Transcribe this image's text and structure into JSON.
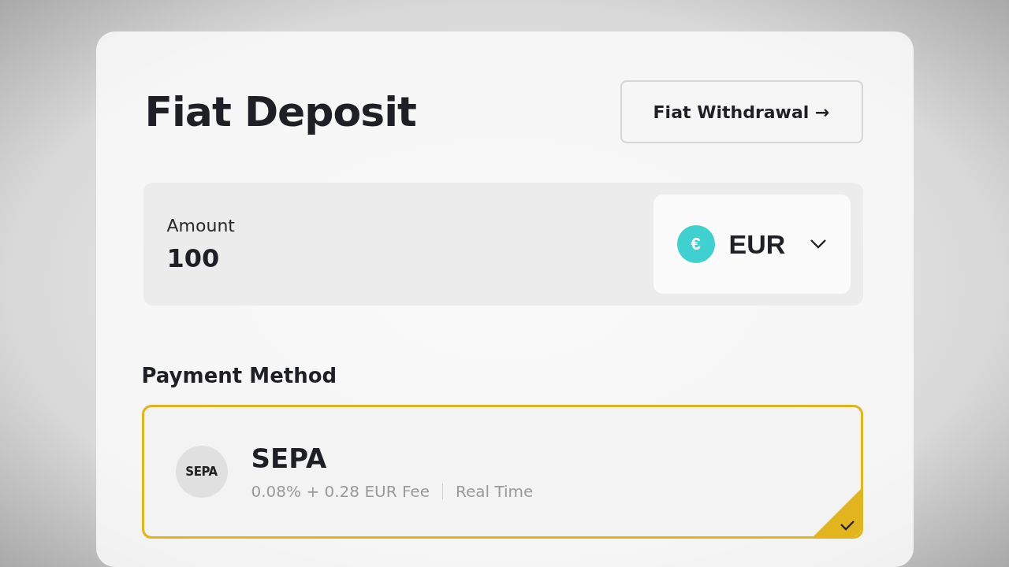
{
  "title": "Fiat Deposit",
  "withdraw_button": {
    "label": "Fiat Withdrawal →"
  },
  "amount": {
    "label": "Amount",
    "value": "100"
  },
  "currency": {
    "symbol": "€",
    "code": "EUR",
    "color": "#3fd0d0"
  },
  "payment_method": {
    "heading": "Payment Method",
    "options": [
      {
        "logo": "SEPA",
        "name": "SEPA",
        "fee": "0.08% + 0.28 EUR Fee",
        "speed": "Real Time",
        "selected": true
      }
    ]
  }
}
